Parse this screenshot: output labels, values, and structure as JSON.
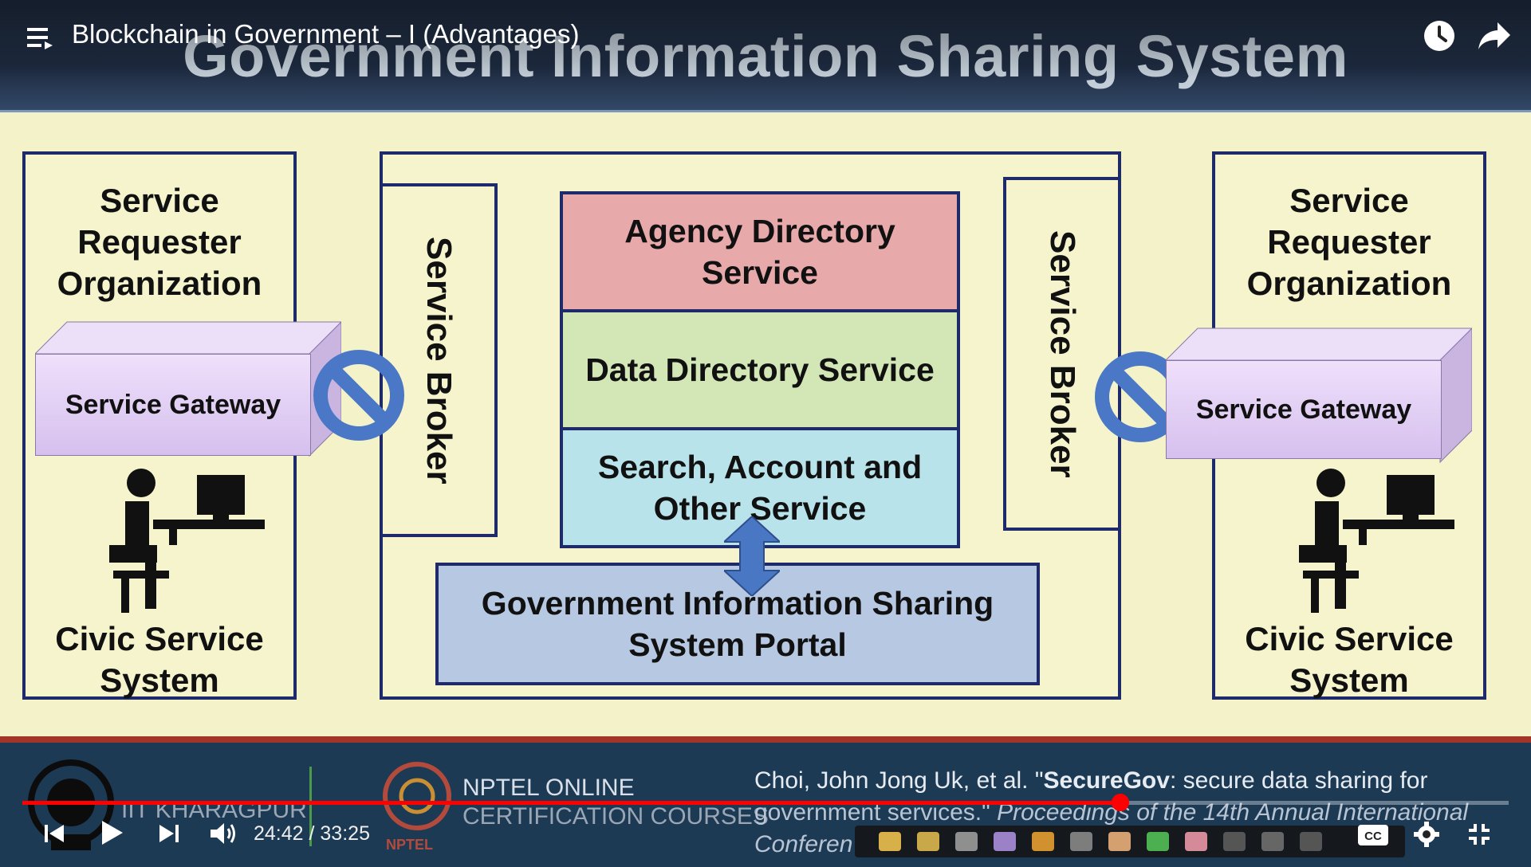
{
  "player": {
    "video_title": "Blockchain in Government – I (Advantages)",
    "time_current": "24:42",
    "time_separator": " / ",
    "time_total": "33:25",
    "progress": 0.739,
    "accent": "#ff0000",
    "icons": [
      "menu-icon",
      "clock-icon",
      "share-icon",
      "skip-previous-icon",
      "play-icon",
      "skip-next-icon",
      "volume-icon",
      "cc-icon",
      "settings-icon",
      "exit-fullscreen-icon"
    ]
  },
  "slide": {
    "title": "Government Information Sharing System",
    "left_org": {
      "title": "Service\nRequester\nOrganization",
      "gateway": "Service Gateway",
      "system": "Civic Service\nSystem"
    },
    "right_org": {
      "title": "Service\nRequester\nOrganization",
      "gateway": "Service Gateway",
      "system": "Civic Service\nSystem"
    },
    "broker_left": "Service Broker",
    "broker_right": "Service Broker",
    "services": [
      {
        "label": "Agency Directory\nService",
        "color": "#e8a9ab"
      },
      {
        "label": "Data Directory Service",
        "color": "#d3e6b6"
      },
      {
        "label": "Search, Account and\nOther Service",
        "color": "#b9e3ea"
      }
    ],
    "portal": "Government Information Sharing\nSystem Portal",
    "portal_color": "#b7c8e2"
  },
  "footer": {
    "institute": "IIT KHARAGPUR",
    "nptel_line1": "NPTEL ONLINE",
    "nptel_line2": "CERTIFICATION COURSES",
    "nptel_logo_text": "NPTEL",
    "citation_line1_pre": "Choi, John Jong Uk, et al. \"",
    "citation_bold": "SecureGov",
    "citation_line1_post": ": secure data sharing for",
    "citation_line2_pre": "government services.\" ",
    "citation_line2_italic": "Proceedings of the 14th Annual International",
    "citation_line3": "Conferen"
  }
}
